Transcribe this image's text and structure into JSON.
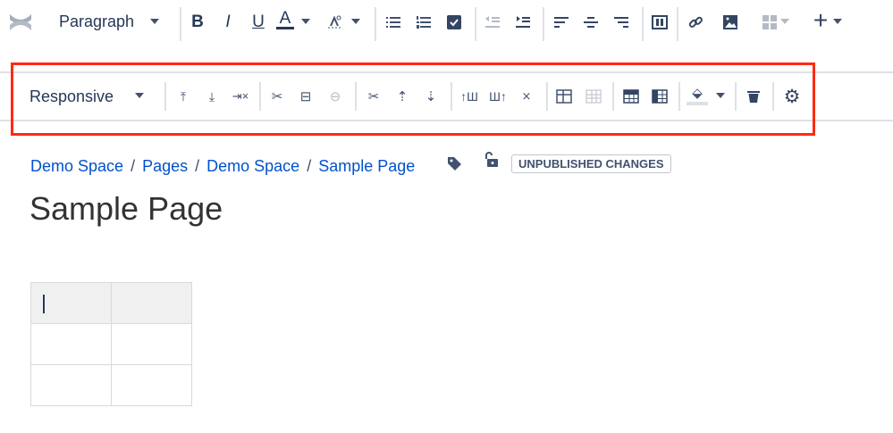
{
  "toolbar": {
    "paragraph": "Paragraph",
    "bold": "B",
    "italic": "I",
    "underline": "U",
    "text_color": "A",
    "plus": "+"
  },
  "table_toolbar": {
    "layout": "Responsive"
  },
  "breadcrumb": [
    "Demo Space",
    "Pages",
    "Demo Space",
    "Sample Page"
  ],
  "breadcrumb_sep": "/",
  "status_badge": "UNPUBLISHED CHANGES",
  "page_title": "Sample Page",
  "colors": {
    "accent": "#0052cc",
    "icon": "#42526e",
    "highlight": "#ff2a12"
  }
}
